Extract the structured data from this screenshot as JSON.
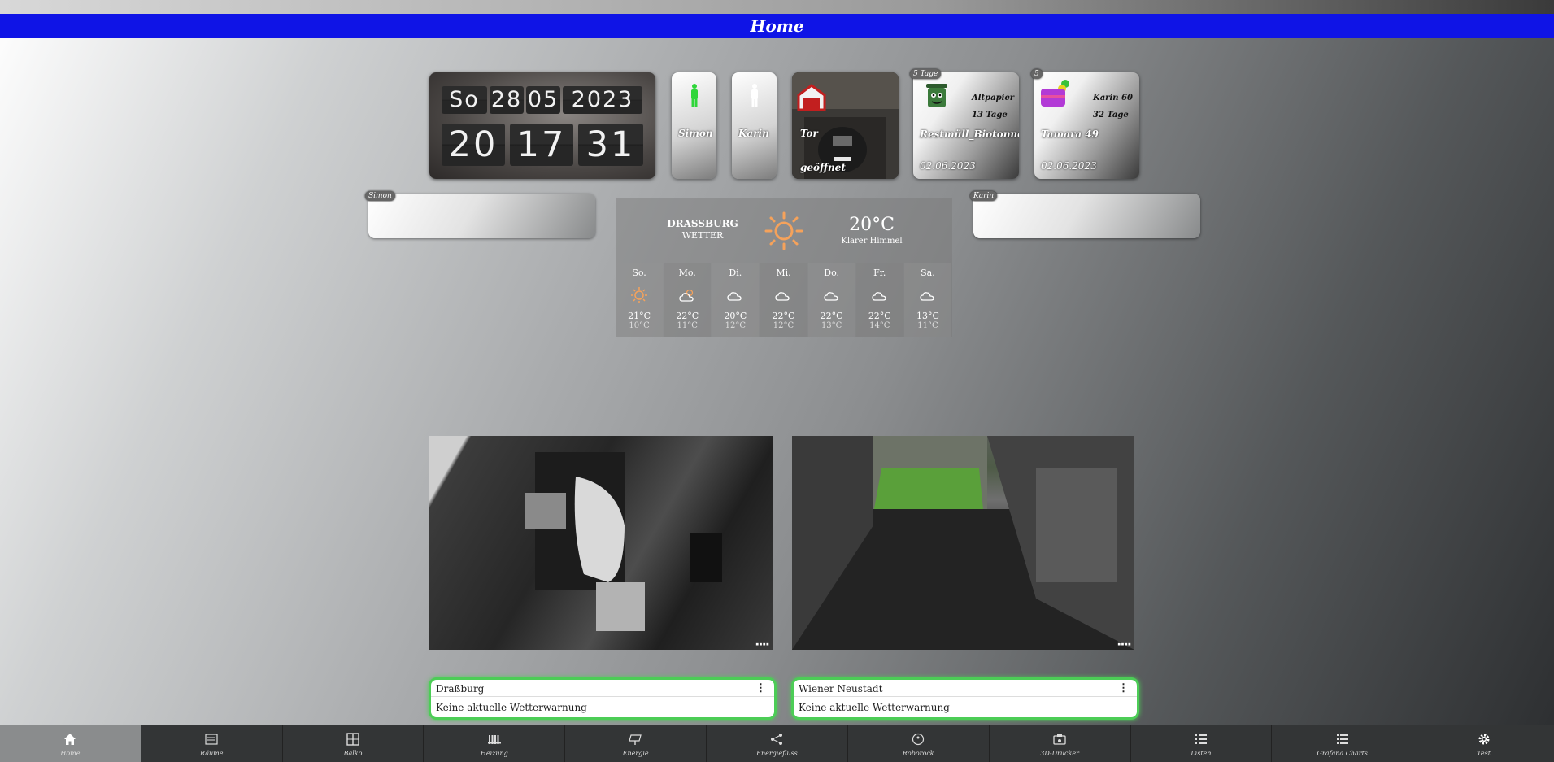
{
  "header": {
    "title": "Home"
  },
  "clock": {
    "weekday": "So",
    "day": "28",
    "month": "05",
    "year": "2023",
    "hour": "20",
    "minute": "17",
    "second": "31"
  },
  "presence": [
    {
      "name": "Simon",
      "color": "#2fd63a"
    },
    {
      "name": "Karin",
      "color": "#ffffff"
    }
  ],
  "garage": {
    "line1": "Tor",
    "line2": "geöffnet"
  },
  "trash": {
    "badge": "5 Tage",
    "type": "Altpapier",
    "days": "13 Tage",
    "name": "Restmüll_Biotonne",
    "date": "02.06.2023"
  },
  "birthday": {
    "badge": "5",
    "name1": "Karin 60",
    "days": "32 Tage",
    "name2": "Tamara 49",
    "date": "02.06.2023"
  },
  "blank_tiles": {
    "left_badge": "Simon",
    "right_badge": "Karin"
  },
  "weather": {
    "city": "DRASSBURG",
    "subtitle": "WETTER",
    "temp": "20°C",
    "desc": "Klarer Himmel",
    "days": [
      {
        "name": "So.",
        "icon": "sun-icon",
        "hi": "21°C",
        "lo": "10°C"
      },
      {
        "name": "Mo.",
        "icon": "partly-cloudy-icon",
        "hi": "22°C",
        "lo": "11°C"
      },
      {
        "name": "Di.",
        "icon": "cloud-icon",
        "hi": "20°C",
        "lo": "12°C"
      },
      {
        "name": "Mi.",
        "icon": "cloud-icon",
        "hi": "22°C",
        "lo": "12°C"
      },
      {
        "name": "Do.",
        "icon": "cloud-icon",
        "hi": "22°C",
        "lo": "13°C"
      },
      {
        "name": "Fr.",
        "icon": "cloud-icon",
        "hi": "22°C",
        "lo": "14°C"
      },
      {
        "name": "Sa.",
        "icon": "cloud-icon",
        "hi": "13°C",
        "lo": "11°C"
      }
    ]
  },
  "warnings": [
    {
      "city": "Draßburg",
      "message": "Keine aktuelle Wetterwarnung"
    },
    {
      "city": "Wiener Neustadt",
      "message": "Keine aktuelle Wetterwarnung"
    }
  ],
  "nav": [
    {
      "label": "Home",
      "icon": "home-icon"
    },
    {
      "label": "Räume",
      "icon": "rooms-icon"
    },
    {
      "label": "Balko",
      "icon": "window-icon"
    },
    {
      "label": "Heizung",
      "icon": "radiator-icon"
    },
    {
      "label": "Energie",
      "icon": "solar-icon"
    },
    {
      "label": "Energiefluss",
      "icon": "flow-icon"
    },
    {
      "label": "Roborock",
      "icon": "robot-icon"
    },
    {
      "label": "3D-Drucker",
      "icon": "printer-icon"
    },
    {
      "label": "Listen",
      "icon": "list-icon"
    },
    {
      "label": "Grafana Charts",
      "icon": "list-icon"
    },
    {
      "label": "Test",
      "icon": "gear-icon"
    }
  ]
}
